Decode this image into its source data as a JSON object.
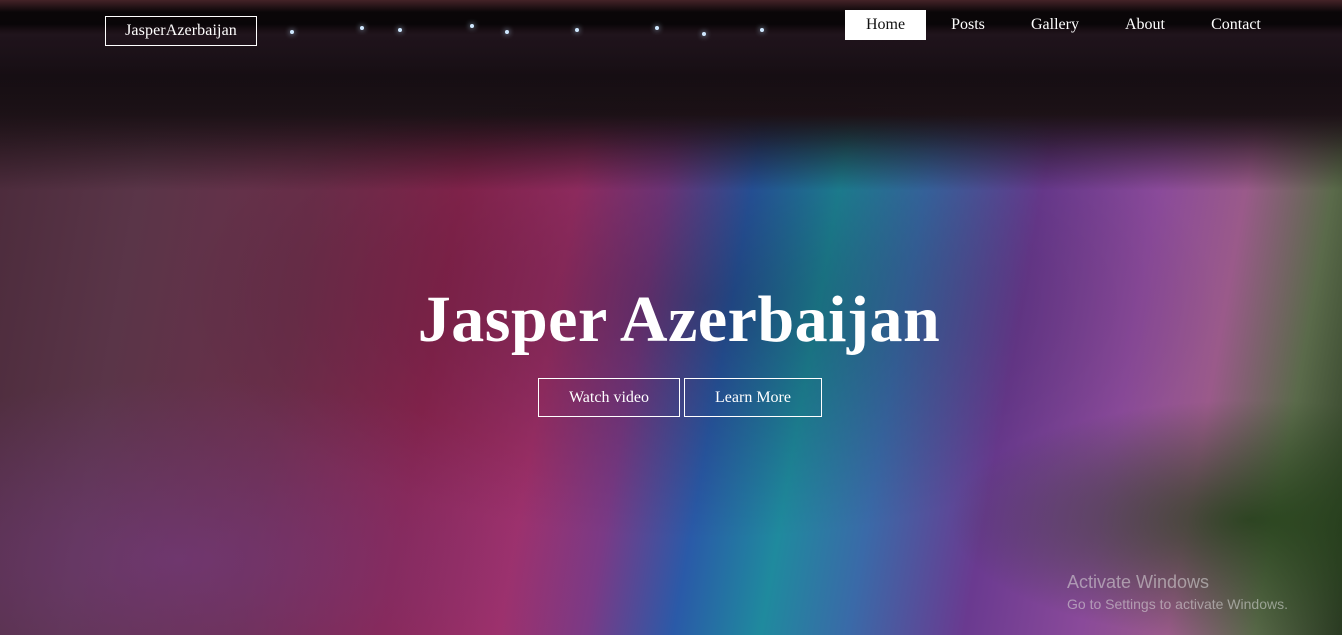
{
  "brand": {
    "label": "JasperAzerbaijan"
  },
  "nav": {
    "items": [
      {
        "label": "Home",
        "active": true
      },
      {
        "label": "Posts",
        "active": false
      },
      {
        "label": "Gallery",
        "active": false
      },
      {
        "label": "About",
        "active": false
      },
      {
        "label": "Contact",
        "active": false
      }
    ]
  },
  "hero": {
    "title": "Jasper Azerbaijan",
    "watch_label": "Watch video",
    "learn_label": "Learn More"
  },
  "watermark": {
    "title": "Activate Windows",
    "subtitle": "Go to Settings to activate Windows."
  },
  "colors": {
    "accent": "#ffffff",
    "text": "#ffffff",
    "active_nav_text": "#111111"
  }
}
